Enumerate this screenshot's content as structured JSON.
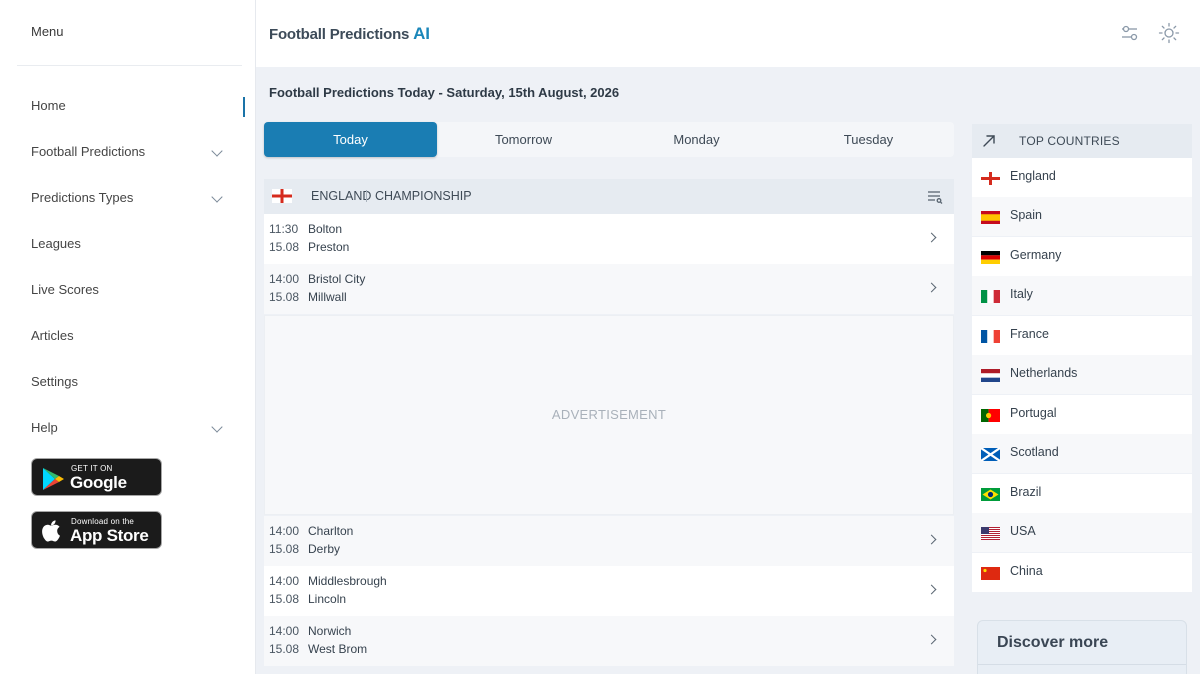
{
  "sidebar": {
    "menu_title": "Menu",
    "items": [
      {
        "label": "Home",
        "has_chevron": false,
        "active": true
      },
      {
        "label": "Football Predictions",
        "has_chevron": true
      },
      {
        "label": "Predictions Types",
        "has_chevron": true
      },
      {
        "label": "Leagues",
        "has_chevron": false
      },
      {
        "label": "Live Scores",
        "has_chevron": false
      },
      {
        "label": "Articles",
        "has_chevron": false
      },
      {
        "label": "Settings",
        "has_chevron": false
      },
      {
        "label": "Help",
        "has_chevron": true
      }
    ],
    "google_play": {
      "small": "GET IT ON",
      "big": "Google Play"
    },
    "app_store": {
      "small": "Download on the",
      "big": "App Store"
    }
  },
  "header": {
    "brand_main": "Football Predictions",
    "brand_ai": "AI",
    "icons": [
      "filter-settings-icon",
      "sun-icon"
    ]
  },
  "main": {
    "date_title": "Football Predictions Today - Saturday, 15th August, 2026",
    "tabs": [
      "Today",
      "Tomorrow",
      "Monday",
      "Tuesday"
    ],
    "active_tab": "Today",
    "league": {
      "country": "ENGLAND",
      "name": "CHAMPIONSHIP"
    },
    "matches_top": [
      {
        "time": "11:30",
        "date": "15.08",
        "home": "Bolton",
        "away": "Preston"
      },
      {
        "time": "14:00",
        "date": "15.08",
        "home": "Bristol City",
        "away": "Millwall"
      }
    ],
    "advertisement": "ADVERTISEMENT",
    "matches_bottom": [
      {
        "time": "14:00",
        "date": "15.08",
        "home": "Charlton",
        "away": "Derby"
      },
      {
        "time": "14:00",
        "date": "15.08",
        "home": "Middlesbrough",
        "away": "Lincoln"
      },
      {
        "time": "14:00",
        "date": "15.08",
        "home": "Norwich",
        "away": "West Brom"
      }
    ]
  },
  "right": {
    "title": "TOP COUNTRIES",
    "countries": [
      "England",
      "Spain",
      "Germany",
      "Italy",
      "France",
      "Netherlands",
      "Portugal",
      "Scotland",
      "Brazil",
      "USA",
      "China"
    ],
    "discover": "Discover more"
  },
  "colors": {
    "accent": "#1a7db3",
    "brand_ai": "#1a86b9"
  }
}
